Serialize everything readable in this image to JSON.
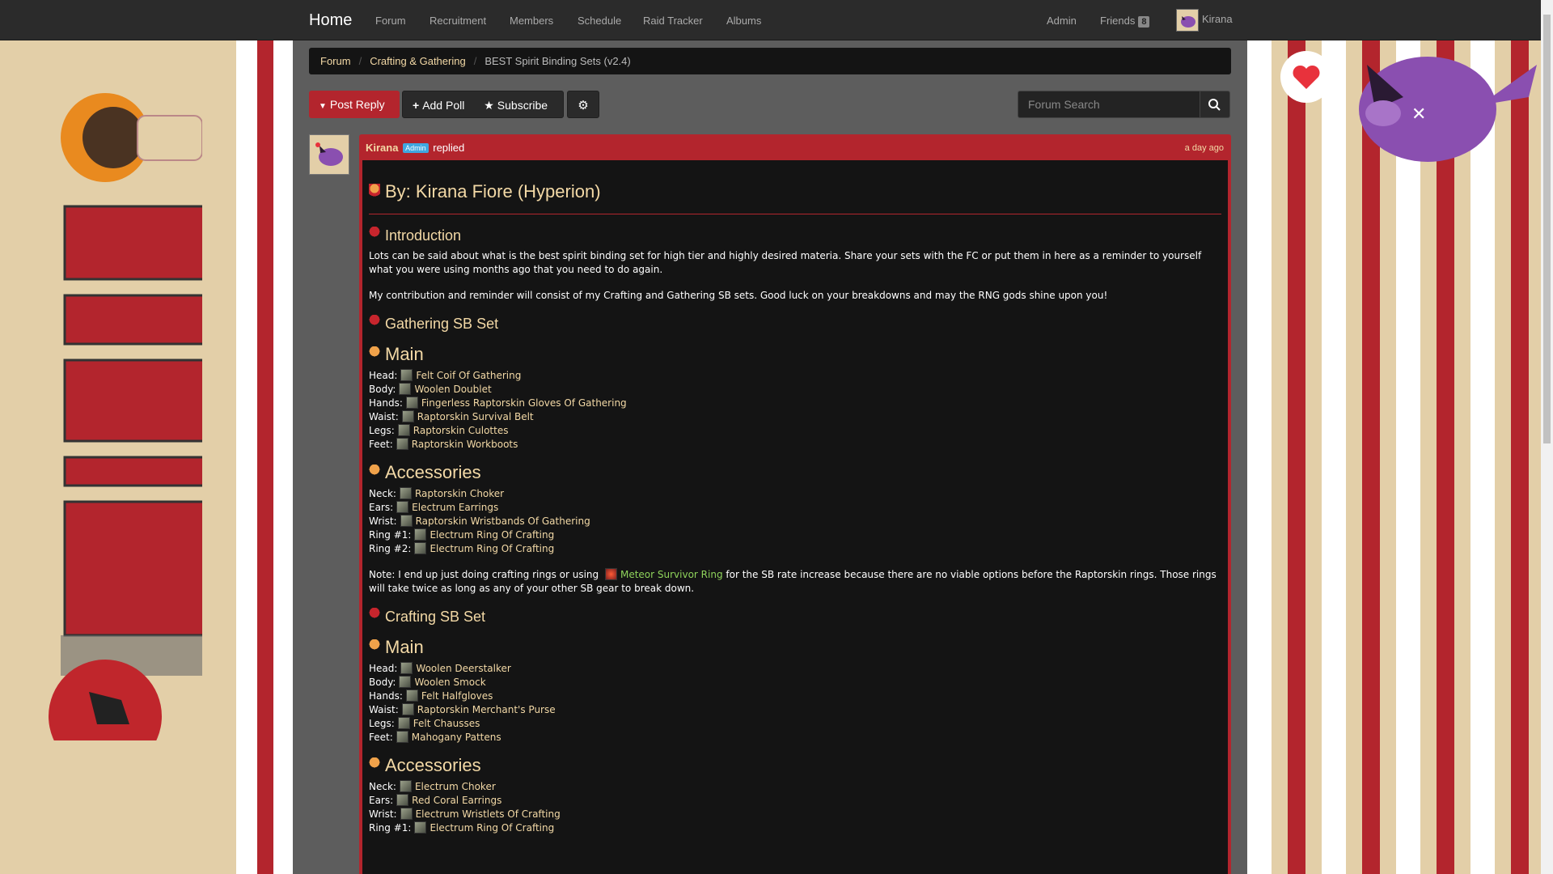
{
  "navbar": {
    "brand": "Home",
    "items": [
      "Forum",
      "Recruitment",
      "Members",
      "Schedule",
      "Raid Tracker",
      "Albums"
    ],
    "admin": "Admin",
    "friends": "Friends",
    "friends_count": "8",
    "user": "Kirana"
  },
  "breadcrumb": {
    "forum": "Forum",
    "category": "Crafting & Gathering",
    "current": "BEST Spirit Binding Sets (v2.4)"
  },
  "toolbar": {
    "post_reply": "Post Reply",
    "add_poll": "Add Poll",
    "subscribe": "Subscribe",
    "search_placeholder": "Forum Search"
  },
  "post": {
    "author": "Kirana",
    "badge": "Admin",
    "action": "replied",
    "time": "a day ago",
    "title": "By: Kirana Fiore (Hyperion)",
    "intro_heading": "Introduction",
    "intro_p1": "Lots can be said about what is the best spirit binding set for high tier and highly desired materia. Share your sets with the FC or put them in here as a reminder to yourself what you were using months ago that you need to do again.",
    "intro_p2": "My contribution and reminder will consist of my Crafting and Gathering SB sets. Good luck on your breakdowns and may the RNG gods shine upon you!",
    "gathering_heading": "Gathering SB Set",
    "main_heading": "Main",
    "accessories_heading": "Accessories",
    "gathering_main": [
      {
        "slot": "Head:",
        "item": "Felt Coif Of Gathering"
      },
      {
        "slot": "Body:",
        "item": "Woolen Doublet"
      },
      {
        "slot": "Hands:",
        "item": "Fingerless Raptorskin Gloves Of Gathering"
      },
      {
        "slot": "Waist:",
        "item": "Raptorskin Survival Belt"
      },
      {
        "slot": "Legs:",
        "item": "Raptorskin Culottes"
      },
      {
        "slot": "Feet:",
        "item": "Raptorskin Workboots"
      }
    ],
    "gathering_acc": [
      {
        "slot": "Neck:",
        "item": "Raptorskin Choker"
      },
      {
        "slot": "Ears:",
        "item": "Electrum Earrings"
      },
      {
        "slot": "Wrist:",
        "item": "Raptorskin Wristbands Of Gathering"
      },
      {
        "slot": "Ring #1:",
        "item": "Electrum Ring Of Crafting"
      },
      {
        "slot": "Ring #2:",
        "item": "Electrum Ring Of Crafting"
      }
    ],
    "note_before": "Note: I end up just doing crafting rings or using",
    "note_link": "Meteor Survivor Ring",
    "note_after": "for the SB rate increase because there are no viable options before the Raptorskin rings. Those rings will take twice as long as any of your other SB gear to break down.",
    "crafting_heading": "Crafting SB Set",
    "crafting_main": [
      {
        "slot": "Head:",
        "item": "Woolen Deerstalker"
      },
      {
        "slot": "Body:",
        "item": "Woolen Smock"
      },
      {
        "slot": "Hands:",
        "item": "Felt Halfgloves"
      },
      {
        "slot": "Waist:",
        "item": "Raptorskin Merchant's Purse"
      },
      {
        "slot": "Legs:",
        "item": "Felt Chausses"
      },
      {
        "slot": "Feet:",
        "item": "Mahogany Pattens"
      }
    ],
    "crafting_acc": [
      {
        "slot": "Neck:",
        "item": "Electrum Choker"
      },
      {
        "slot": "Ears:",
        "item": "Red Coral Earrings"
      },
      {
        "slot": "Wrist:",
        "item": "Electrum Wristlets Of Crafting"
      },
      {
        "slot": "Ring #1:",
        "item": "Electrum Ring Of Crafting"
      }
    ]
  },
  "colors": {
    "accent_red": "#b3252d",
    "link_gold": "#f3d9a6",
    "link_green": "#8fd35b",
    "navbar": "#2b2b2b"
  }
}
